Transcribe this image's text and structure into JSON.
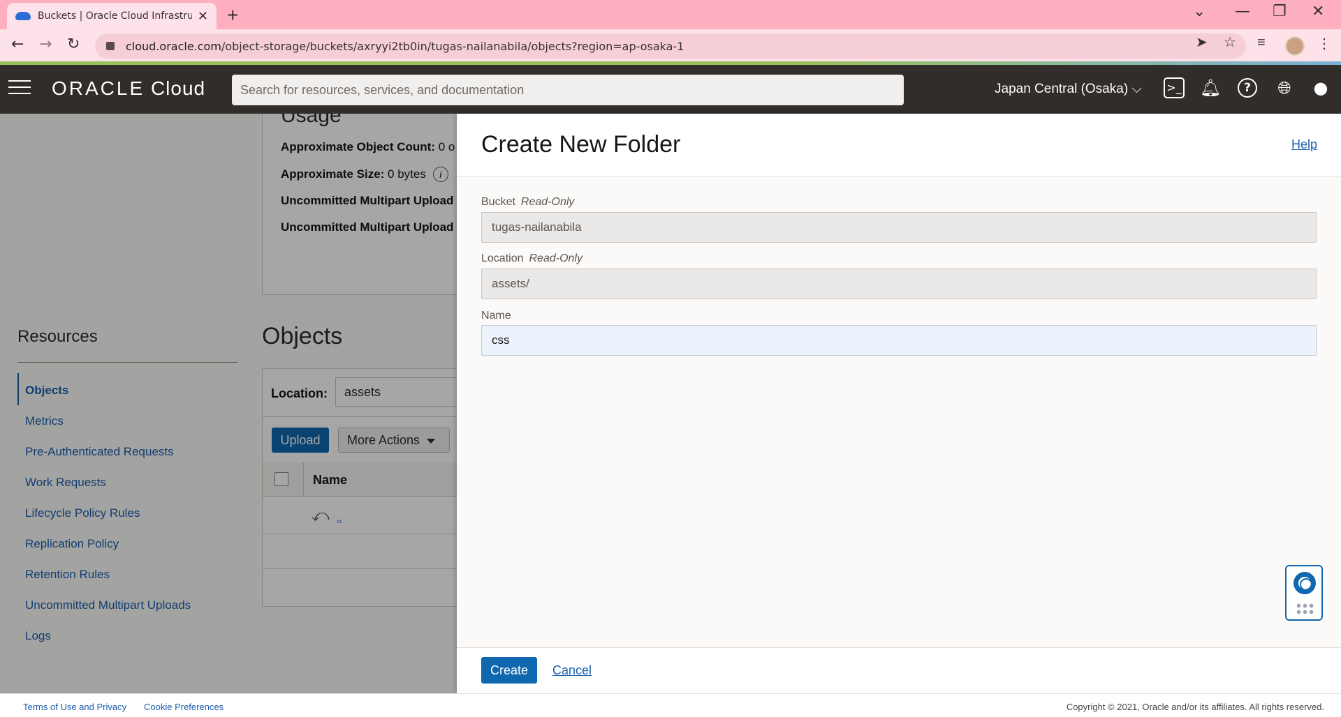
{
  "browser": {
    "tab_title": "Buckets | Oracle Cloud Infrastruct",
    "tab_close": "✕",
    "new_tab": "+",
    "url_host": "cloud.oracle.com",
    "url_path": "/object-storage/buckets/axryyi2tb0in/tugas-nailanabila/objects?region=ap-osaka-1",
    "icons": [
      "back-icon",
      "forward-icon",
      "reload-icon",
      "lock-icon",
      "share-icon",
      "star-icon",
      "media-icon",
      "profile-icon",
      "menu-icon"
    ]
  },
  "header": {
    "logo_brand": "ORACLE",
    "logo_product": "Cloud",
    "search_placeholder": "Search for resources, services, and documentation",
    "region": "Japan Central (Osaka)",
    "region_caret": "⌵"
  },
  "usage": {
    "title": "Usage",
    "rows": [
      {
        "label": "Approximate Object Count:",
        "value": "0 o"
      },
      {
        "label": "Approximate Size:",
        "value": "0 bytes"
      },
      {
        "label": "Uncommitted Multipart Upload",
        "value": ""
      },
      {
        "label": "Uncommitted Multipart Upload",
        "value": ""
      }
    ],
    "info_glyph": "i"
  },
  "resources": {
    "title": "Resources",
    "items": [
      "Objects",
      "Metrics",
      "Pre-Authenticated Requests",
      "Work Requests",
      "Lifecycle Policy Rules",
      "Replication Policy",
      "Retention Rules",
      "Uncommitted Multipart Uploads",
      "Logs"
    ],
    "active_index": 0
  },
  "objects": {
    "title": "Objects",
    "location_label": "Location:",
    "location_value": "assets",
    "upload_label": "Upload",
    "more_actions_label": "More Actions",
    "col_name": "Name",
    "parent_link": "..",
    "back_glyph": "⤺"
  },
  "panel": {
    "title": "Create New Folder",
    "help": "Help",
    "fields": [
      {
        "label": "Bucket",
        "qualifier": "Read-Only",
        "value": "tugas-nailanabila"
      },
      {
        "label": "Location",
        "qualifier": "Read-Only",
        "value": "assets/"
      },
      {
        "label": "Name",
        "qualifier": "",
        "value": "css"
      }
    ],
    "create_label": "Create",
    "cancel_label": "Cancel"
  },
  "footer": {
    "terms": "Terms of Use and Privacy",
    "cookies": "Cookie Preferences",
    "copyright": "Copyright © 2021, Oracle and/or its affiliates. All rights reserved."
  },
  "colors": {
    "oci_header": "#312d2a",
    "primary_button": "#0f67b0",
    "link": "#1b5fad",
    "browser_tabbar": "#fdafc0"
  }
}
